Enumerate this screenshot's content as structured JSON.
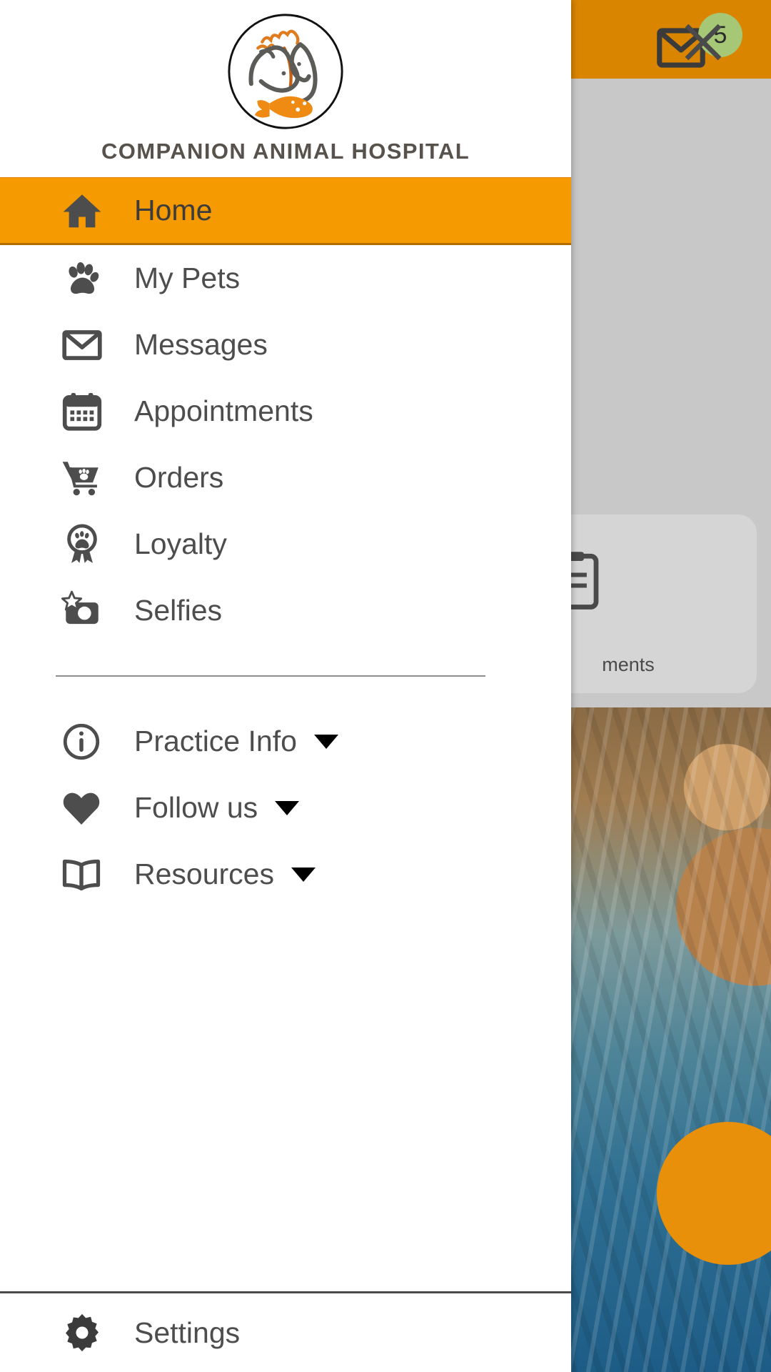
{
  "brand": {
    "name": "COMPANION ANIMAL HOSPITAL",
    "logo_alt": "companion-animal-hospital-logo",
    "accent_orange": "#f59a00",
    "header_orange": "#d98500",
    "text_gray": "#4d4d4d",
    "brand_text_color": "#58524c"
  },
  "drawer": {
    "close_label": "×",
    "close_icon": "close-icon",
    "primary_items": [
      {
        "label": "Home",
        "icon": "home-icon",
        "active": true,
        "has_caret": false
      },
      {
        "label": "My Pets",
        "icon": "paw-icon",
        "active": false,
        "has_caret": false
      },
      {
        "label": "Messages",
        "icon": "envelope-icon",
        "active": false,
        "has_caret": false
      },
      {
        "label": "Appointments",
        "icon": "calendar-icon",
        "active": false,
        "has_caret": false
      },
      {
        "label": "Orders",
        "icon": "cart-paw-icon",
        "active": false,
        "has_caret": false
      },
      {
        "label": "Loyalty",
        "icon": "award-paw-icon",
        "active": false,
        "has_caret": false
      },
      {
        "label": "Selfies",
        "icon": "camera-star-icon",
        "active": false,
        "has_caret": false
      }
    ],
    "secondary_items": [
      {
        "label": "Practice Info",
        "icon": "info-circle-icon",
        "has_caret": true
      },
      {
        "label": "Follow us",
        "icon": "heart-icon",
        "has_caret": true
      },
      {
        "label": "Resources",
        "icon": "open-book-icon",
        "has_caret": true
      }
    ],
    "footer_items": [
      {
        "label": "Settings",
        "icon": "gear-icon",
        "has_caret": false
      }
    ]
  },
  "background_app": {
    "message_badge_count": "5",
    "message_badge_color": "#a5c776",
    "mail_icon": "envelope-icon",
    "card_label": "ments",
    "card_icon": "clipboard-icon"
  }
}
